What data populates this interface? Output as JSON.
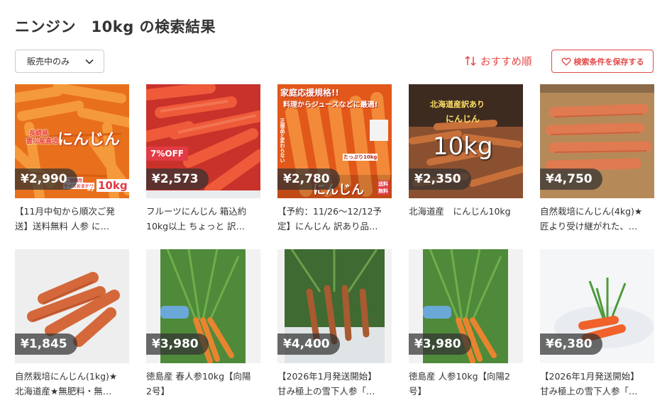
{
  "header": {
    "title": "ニンジン　10kg の検索結果"
  },
  "filter": {
    "selected": "販売中のみ",
    "icon": "chevron-down-icon"
  },
  "sort": {
    "label": "おすすめ順",
    "icon": "sort-arrows-icon"
  },
  "save_search": {
    "label": "検索条件を保存する",
    "icon": "heart-icon"
  },
  "colors": {
    "accent": "#e34a4a",
    "price_tag_bg": "#323232",
    "off_badge": "#e23b45"
  },
  "items": [
    {
      "price": "¥2,990",
      "line1": "【11月中旬から順次ご発",
      "line2": "送】送料無料 人参 に…",
      "overlay": {
        "t1": "長崎県",
        "t2": "雲仙産直送",
        "t3": "にんじん",
        "t4": "二種類用",
        "t5": "サイズおまかせ",
        "t6": "約",
        "t7": "10kg"
      }
    },
    {
      "price": "¥2,573",
      "badge": "7%OFF",
      "line1": "フルーツにんじん 箱込約",
      "line2": "10kg以上 ちょっと 訳…"
    },
    {
      "price": "¥2,780",
      "line1": "【予約：11/26〜12/12予",
      "line2": "定】にんじん 訳あり品…",
      "overlay": {
        "t1": "家庭応援規格!!",
        "t2": "料理からジュースなどに最適!",
        "t3": "たっぷり10kg",
        "t4": "にんじん",
        "t5": "送料",
        "t6": "無料",
        "t7": "正規品と変わらない"
      }
    },
    {
      "price": "¥2,350",
      "line1": "北海道産　にんじん10kg",
      "line2": "",
      "overlay": {
        "t1": "北海道産訳あり",
        "t2": "にんじん",
        "t3": "10kg"
      }
    },
    {
      "price": "¥4,750",
      "line1": "自然栽培にんじん(4kg)★",
      "line2": "匠より受け継がれた、…"
    },
    {
      "price": "¥1,845",
      "line1": "自然栽培にんじん(1kg)★",
      "line2": "北海道産★無肥料・無…"
    },
    {
      "price": "¥3,980",
      "line1": "徳島産 春人参10kg【向陽",
      "line2": "2号】"
    },
    {
      "price": "¥4,400",
      "line1": "【2026年1月発送開始】",
      "line2": "甘み極上の雪下人参「…"
    },
    {
      "price": "¥3,980",
      "line1": "徳島産 人参10kg【向陽2",
      "line2": "号】"
    },
    {
      "price": "¥6,380",
      "line1": "【2026年1月発送開始】",
      "line2": "甘み極上の雪下人参「…"
    }
  ]
}
